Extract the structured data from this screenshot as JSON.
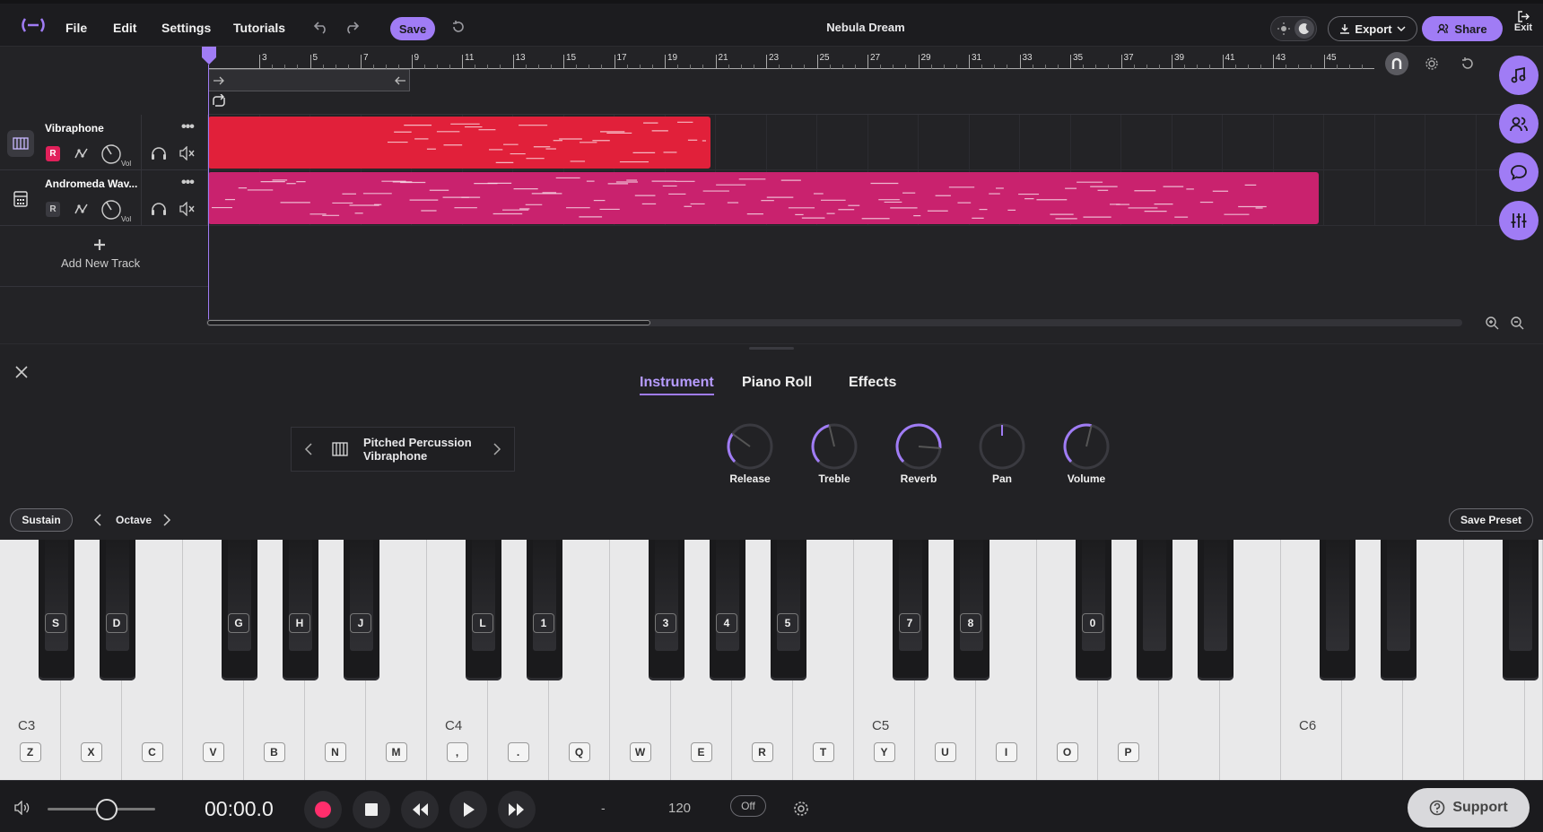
{
  "topbar": {
    "menus": [
      "File",
      "Edit",
      "Settings",
      "Tutorials"
    ],
    "save_label": "Save",
    "project_title": "Nebula Dream",
    "export_label": "Export",
    "share_label": "Share",
    "exit_label": "Exit",
    "accent": "#a07cf5"
  },
  "ruler": {
    "ticks": [
      "3",
      "5",
      "7",
      "9",
      "11",
      "13",
      "15",
      "17",
      "19",
      "21",
      "23",
      "25",
      "27",
      "29",
      "31",
      "33",
      "35",
      "37",
      "39",
      "41",
      "43",
      "45"
    ]
  },
  "tracks": [
    {
      "name": "Vibraphone",
      "rec": "R",
      "vol": "Vol",
      "clip_color": "#e1203a",
      "rec_active": true
    },
    {
      "name": "Andromeda Wav...",
      "rec": "R",
      "vol": "Vol",
      "clip_color": "#c9226e",
      "rec_active": false
    }
  ],
  "add_track_label": "Add New Track",
  "panel": {
    "tabs": [
      "Instrument",
      "Piano Roll",
      "Effects"
    ],
    "active_tab": "Instrument",
    "instrument": {
      "category": "Pitched Percussion",
      "name": "Vibraphone"
    },
    "knobs": [
      {
        "label": "Release",
        "level": 0.3
      },
      {
        "label": "Treble",
        "level": 0.45
      },
      {
        "label": "Reverb",
        "level": 0.85
      },
      {
        "label": "Pan",
        "level": 0.5
      },
      {
        "label": "Volume",
        "level": 0.55
      }
    ],
    "sustain_label": "Sustain",
    "octave_label": "Octave",
    "save_preset_label": "Save Preset"
  },
  "keyboard": {
    "octave_labels": [
      "C3",
      "C4",
      "C5",
      "C6"
    ],
    "white_keys": [
      "Z",
      "X",
      "C",
      "V",
      "B",
      "N",
      "M",
      ",",
      ".",
      "Q",
      "W",
      "E",
      "R",
      "T",
      "Y",
      "U",
      "I",
      "O",
      "P",
      "",
      "",
      "",
      "",
      "",
      "",
      ""
    ],
    "black_keys": [
      "S",
      "D",
      "G",
      "H",
      "J",
      "L",
      "1",
      "3",
      "4",
      "5",
      "7",
      "8",
      "0",
      "",
      "",
      "",
      "",
      ""
    ]
  },
  "transport": {
    "time": "00:00.0",
    "time_signature": "-",
    "tempo": "120",
    "metronome": "Off",
    "support_label": "Support",
    "volume_level": 0.55
  }
}
